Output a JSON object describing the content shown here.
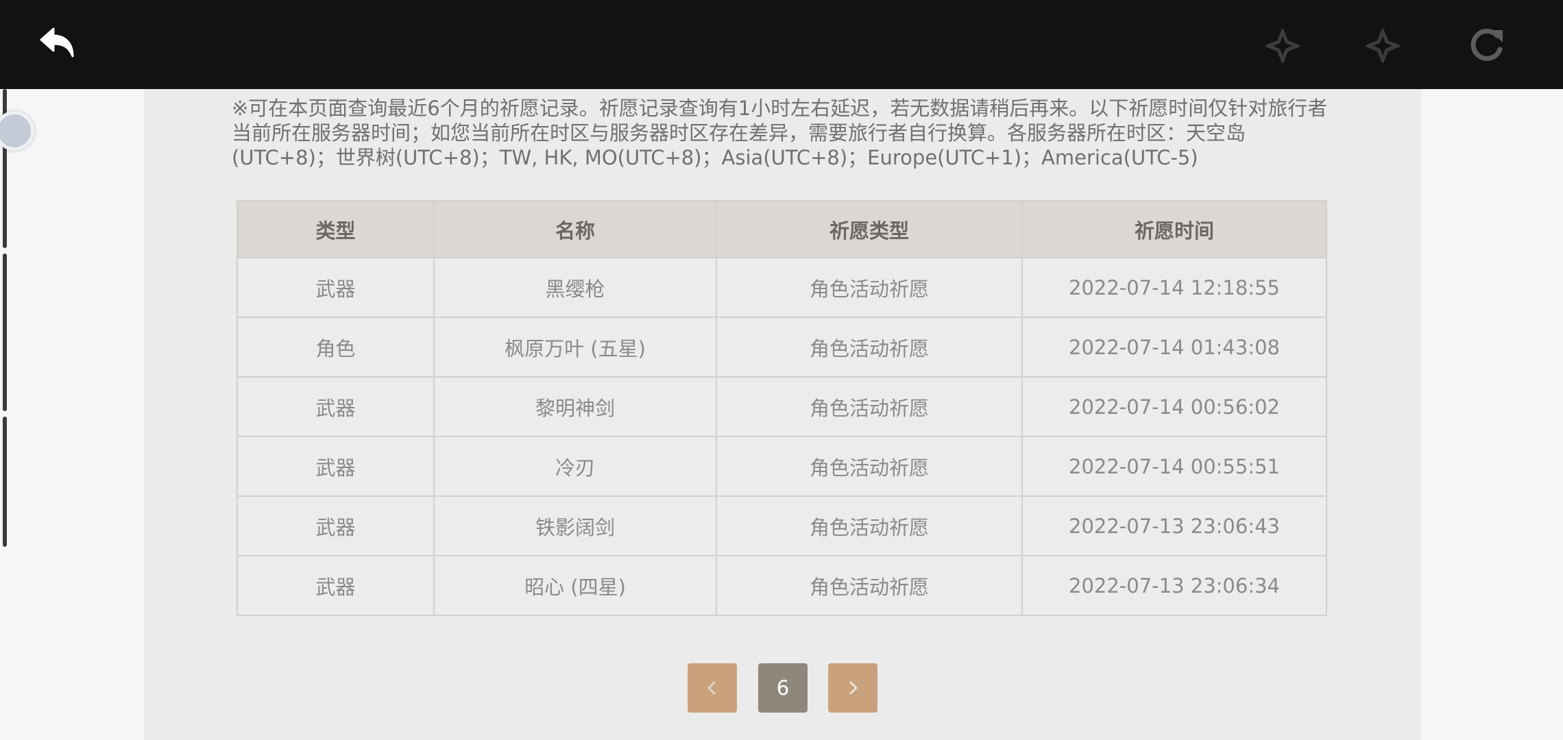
{
  "toolbar": {
    "back_icon": "back-arrow-icon",
    "forward_icons": [
      "forward-star-icon",
      "forward-star-icon"
    ],
    "refresh_icon": "refresh-icon"
  },
  "notice": "※可在本页面查询最近6个月的祈愿记录。祈愿记录查询有1小时左右延迟，若无数据请稍后再来。以下祈愿时间仅针对旅行者当前所在服务器时间；如您当前所在时区与服务器时区存在差异，需要旅行者自行换算。各服务器所在时区：天空岛(UTC+8)；世界树(UTC+8)；TW, HK, MO(UTC+8)；Asia(UTC+8)；Europe(UTC+1)；America(UTC-5)",
  "table": {
    "headers": [
      "类型",
      "名称",
      "祈愿类型",
      "祈愿时间"
    ],
    "rows": [
      {
        "type": "武器",
        "name": "黑缨枪",
        "wish_type": "角色活动祈愿",
        "time": "2022-07-14 12:18:55"
      },
      {
        "type": "角色",
        "name": "枫原万叶 (五星)",
        "wish_type": "角色活动祈愿",
        "time": "2022-07-14 01:43:08"
      },
      {
        "type": "武器",
        "name": "黎明神剑",
        "wish_type": "角色活动祈愿",
        "time": "2022-07-14 00:56:02"
      },
      {
        "type": "武器",
        "name": "冷刃",
        "wish_type": "角色活动祈愿",
        "time": "2022-07-14 00:55:51"
      },
      {
        "type": "武器",
        "name": "铁影阔剑",
        "wish_type": "角色活动祈愿",
        "time": "2022-07-13 23:06:43"
      },
      {
        "type": "武器",
        "name": "昭心 (四星)",
        "wish_type": "角色活动祈愿",
        "time": "2022-07-13 23:06:34"
      }
    ]
  },
  "pagination": {
    "current_page": "6",
    "prev_icon": "chevron-left-icon",
    "next_icon": "chevron-right-icon"
  },
  "colors": {
    "five_star": "#b9713a",
    "four_star": "#a05ac8",
    "pager_button": "#c9a27d",
    "pager_current": "#8f877c"
  }
}
